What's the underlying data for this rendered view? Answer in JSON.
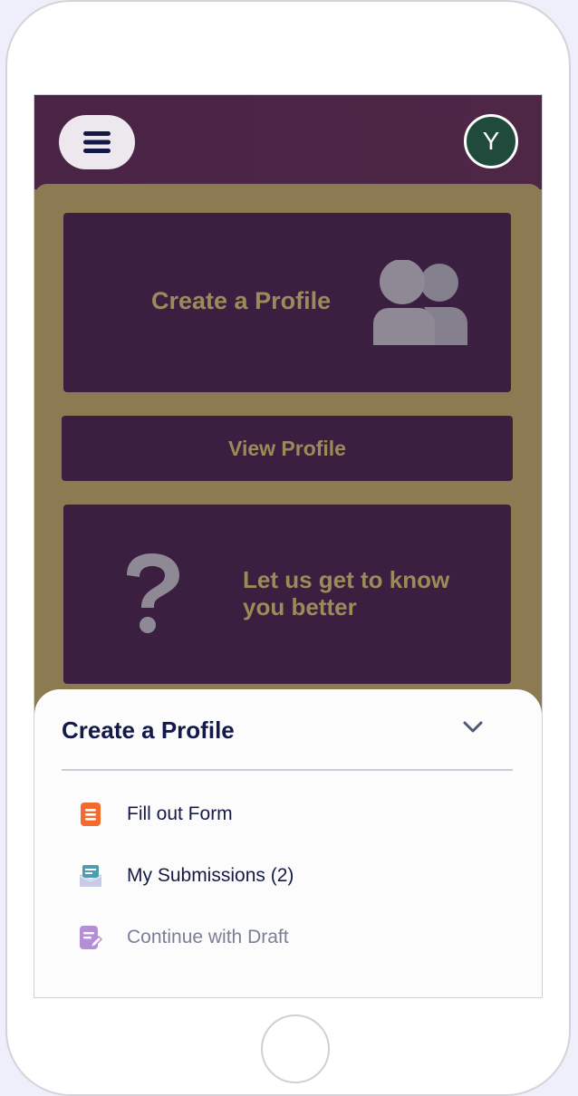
{
  "header": {
    "avatar_initial": "Y"
  },
  "cards": {
    "create_profile": "Create a Profile",
    "view_profile": "View Profile",
    "get_to_know": "Let us get to know you better"
  },
  "sheet": {
    "title": "Create a Profile",
    "items": [
      {
        "label": "Fill out Form",
        "icon": "form-icon",
        "color": "#f26a2e"
      },
      {
        "label": "My Submissions (2)",
        "icon": "submissions-icon",
        "color": "#4e9cb0"
      },
      {
        "label": "Continue with Draft",
        "icon": "draft-icon",
        "color": "#b58ed8"
      }
    ]
  },
  "colors": {
    "header_bg": "#4a2445",
    "page_bg": "#8c7b52",
    "card_bg": "#3b1f40",
    "card_text": "#9d8a5a",
    "avatar_bg": "#1f4a3c",
    "sheet_text": "#131a4a"
  }
}
